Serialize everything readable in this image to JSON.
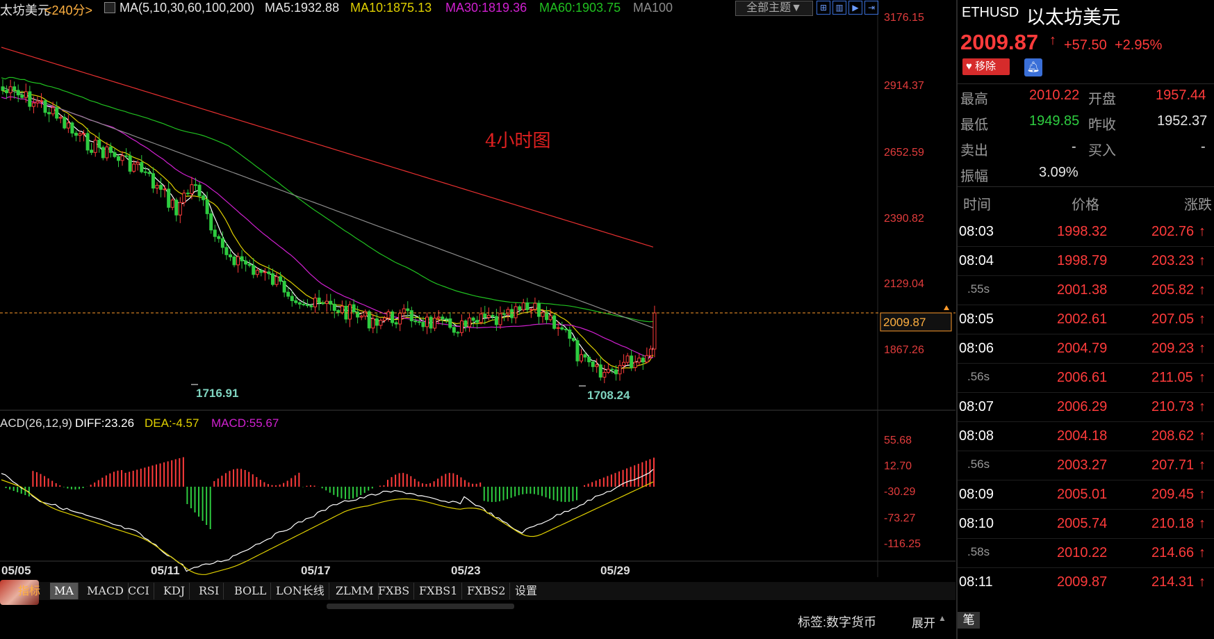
{
  "topbar": {
    "symbol_name": "太坊美元",
    "period": "<240分>",
    "ma_params": "MA(5,10,30,60,100,200)",
    "ma5": "MA5:1932.88",
    "ma10": "MA10:1875.13",
    "ma30": "MA30:1819.36",
    "ma60": "MA60:1903.75",
    "ma100": "MA100",
    "theme_button": "全部主题▼"
  },
  "chart": {
    "annotation": "4小时图",
    "price_axis": [
      "3176.15",
      "2914.37",
      "2652.59",
      "2390.82",
      "2129.04",
      "1867.26"
    ],
    "current_price_tag": "2009.87",
    "low_marker_1": "1716.91",
    "low_marker_2": "1708.24",
    "macd_params": "ACD(26,12,9)",
    "diff": "DIFF:23.26",
    "dea": "DEA:-4.57",
    "macd": "MACD:55.67",
    "macd_axis": [
      "55.68",
      "12.70",
      "-30.29",
      "-73.27",
      "-116.25"
    ],
    "date_axis": [
      "05/05",
      "05/11",
      "05/17",
      "05/23",
      "05/29"
    ],
    "colors": {
      "up": "#ff3b3b",
      "down": "#2ecc40",
      "ma5": "#ffffff",
      "ma10": "#e0d000",
      "ma30": "#d020d0",
      "ma60": "#20c020",
      "ma100": "#8c8c8c",
      "ma200": "#e83030"
    }
  },
  "tabs": {
    "label": "指标",
    "items": [
      "MA",
      "MACD",
      "CCI",
      "KDJ",
      "RSI",
      "BOLL",
      "LON长线",
      "ZLMM",
      "FXBS",
      "FXBS1",
      "FXBS2",
      "设置"
    ]
  },
  "statusbar": {
    "tag_label": "标签:数字货币",
    "expand": "展开",
    "pen": "笔"
  },
  "panel": {
    "symbol": "ETHUSD",
    "name": "以太坊美元",
    "price": "2009.87",
    "change": "+57.50",
    "change_pct": "+2.95%",
    "remove_btn": "移除",
    "high_label": "最高",
    "high": "2010.22",
    "open_label": "开盘",
    "open": "1957.44",
    "low_label": "最低",
    "low": "1949.85",
    "prev_label": "昨收",
    "prev": "1952.37",
    "sell_label": "卖出",
    "sell": "-",
    "buy_label": "买入",
    "buy": "-",
    "amp_label": "振幅",
    "amp": "3.09%",
    "col_time": "时间",
    "col_price": "价格",
    "col_change": "涨跌",
    "trades": [
      {
        "time": "08:03",
        "price": "1998.32",
        "chg": "202.76",
        "sub": false
      },
      {
        "time": "08:04",
        "price": "1998.79",
        "chg": "203.23",
        "sub": false
      },
      {
        "time": ".55s",
        "price": "2001.38",
        "chg": "205.82",
        "sub": true
      },
      {
        "time": "08:05",
        "price": "2002.61",
        "chg": "207.05",
        "sub": false
      },
      {
        "time": "08:06",
        "price": "2004.79",
        "chg": "209.23",
        "sub": false
      },
      {
        "time": ".56s",
        "price": "2006.61",
        "chg": "211.05",
        "sub": true
      },
      {
        "time": "08:07",
        "price": "2006.29",
        "chg": "210.73",
        "sub": false
      },
      {
        "time": "08:08",
        "price": "2004.18",
        "chg": "208.62",
        "sub": false
      },
      {
        "time": ".56s",
        "price": "2003.27",
        "chg": "207.71",
        "sub": true
      },
      {
        "time": "08:09",
        "price": "2005.01",
        "chg": "209.45",
        "sub": false
      },
      {
        "time": "08:10",
        "price": "2005.74",
        "chg": "210.18",
        "sub": false
      },
      {
        "time": ".58s",
        "price": "2010.22",
        "chg": "214.66",
        "sub": true
      },
      {
        "time": "08:11",
        "price": "2009.87",
        "chg": "214.31",
        "sub": false
      }
    ]
  }
}
